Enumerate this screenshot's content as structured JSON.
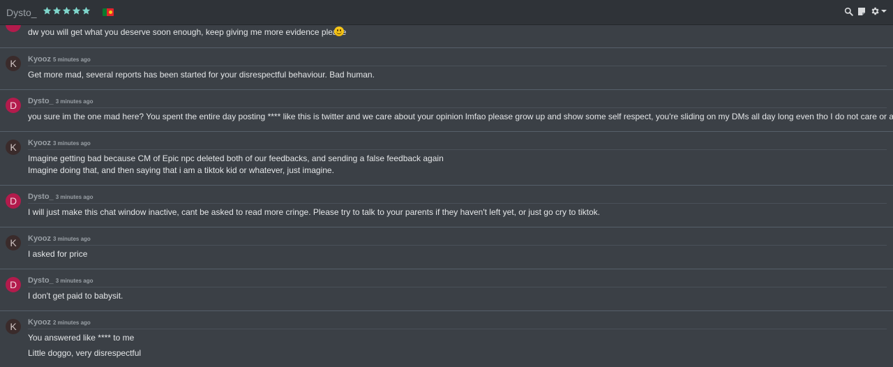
{
  "header": {
    "title": "Dysto_",
    "stars": 5,
    "star_color": "#7fd6cc",
    "flag": "portugal-flag"
  },
  "toolbar": {
    "icons": [
      "search-icon",
      "note-icon",
      "gear-icon",
      "caret-down-icon"
    ]
  },
  "messages": [
    {
      "avatar": "",
      "author": "",
      "time": "",
      "lines": [
        "dw you will get what you deserve soon enough, keep giving me more evidence please"
      ],
      "emoji": "slightly-smiling-face"
    },
    {
      "avatar": "K",
      "author": "Kyooz",
      "time": "5 minutes ago",
      "lines": [
        "Get more mad, several reports has been started for your disrespectful behaviour. Bad human."
      ]
    },
    {
      "avatar": "D",
      "author": "Dysto_",
      "time": "3 minutes ago",
      "lines": [
        "you sure im the one mad here? You spent the entire day posting **** like this is twitter and we care about your opinion lmfao please grow up and show some self respect, you're sliding on my DMs all day long even tho I do not care or asked"
      ]
    },
    {
      "avatar": "K",
      "author": "Kyooz",
      "time": "3 minutes ago",
      "lines": [
        "Imagine getting bad because CM of Epic npc deleted both of our feedbacks, and sending a false feedback again",
        "Imagine doing that, and then saying that i am a tiktok kid or whatever, just imagine."
      ]
    },
    {
      "avatar": "D",
      "author": "Dysto_",
      "time": "3 minutes ago",
      "lines": [
        "I will just make this chat window inactive, cant be asked to read more cringe. Please try to talk to your parents if they haven't left yet, or just go cry to tiktok."
      ]
    },
    {
      "avatar": "K",
      "author": "Kyooz",
      "time": "3 minutes ago",
      "lines": [
        "I asked for price"
      ]
    },
    {
      "avatar": "D",
      "author": "Dysto_",
      "time": "3 minutes ago",
      "lines": [
        "I don't get paid to babysit."
      ]
    },
    {
      "avatar": "K",
      "author": "Kyooz",
      "time": "2 minutes ago",
      "lines": [
        "You answered like **** to me",
        "Little doggo, very disrespectful"
      ]
    }
  ]
}
